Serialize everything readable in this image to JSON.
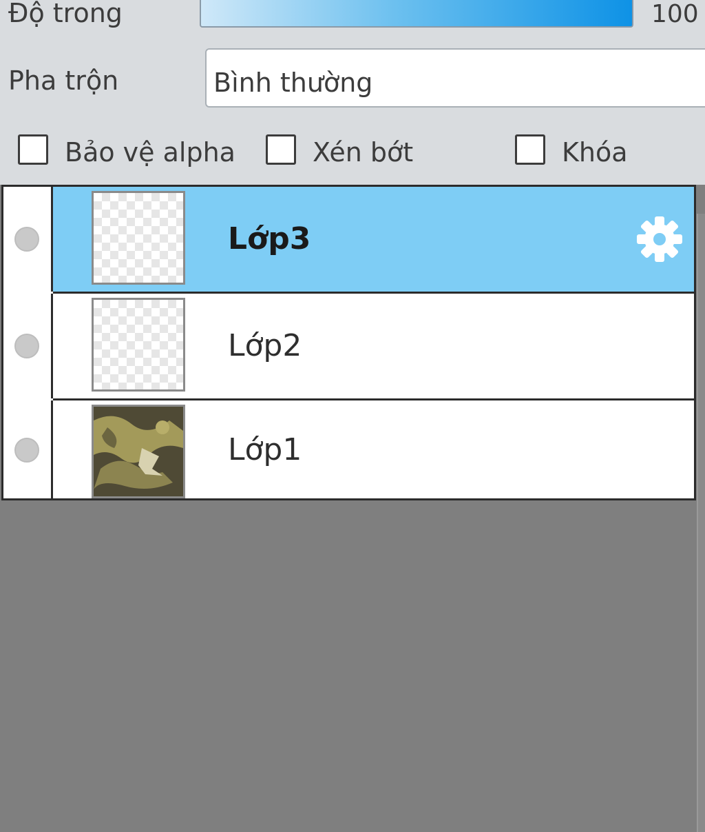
{
  "opacity": {
    "label": "Độ trong",
    "value": "100",
    "level_percent": 100
  },
  "blend": {
    "label": "Pha trộn",
    "value": "Bình thường"
  },
  "options": {
    "protect_alpha": {
      "label": "Bảo vệ alpha",
      "checked": false
    },
    "clipping": {
      "label": "Xén bớt",
      "checked": false
    },
    "lock": {
      "label": "Khóa",
      "checked": false
    }
  },
  "layers": [
    {
      "name": "Lớp3",
      "selected": true,
      "thumbnail": "transparent",
      "visibility_icon": "visibility-dot-icon",
      "settings_icon": "gear-icon"
    },
    {
      "name": "Lớp2",
      "selected": false,
      "thumbnail": "transparent",
      "visibility_icon": "visibility-dot-icon"
    },
    {
      "name": "Lớp1",
      "selected": false,
      "thumbnail": "image",
      "visibility_icon": "visibility-dot-icon"
    }
  ],
  "colors": {
    "selected_row": "#7ecdf5",
    "slider_fill_end": "#0e92e6",
    "empty_area": "#7f7f7f",
    "panel_bg": "#d9dcdf"
  }
}
